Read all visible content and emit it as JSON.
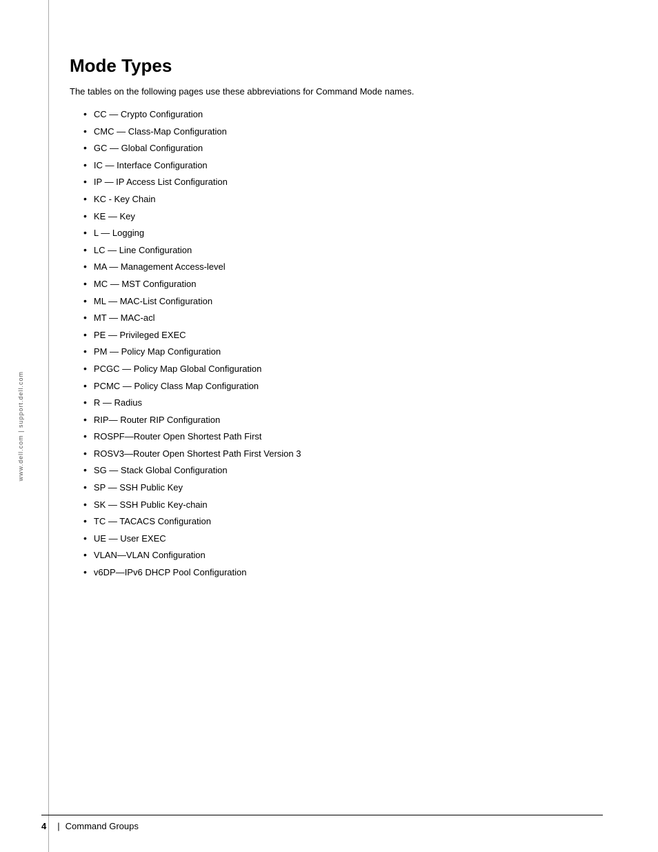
{
  "side_label": {
    "text": "www.dell.com | support.dell.com"
  },
  "page": {
    "title": "Mode Types",
    "intro": "The tables on the following pages use these abbreviations for Command Mode names.",
    "bullet_items": [
      "CC — Crypto Configuration",
      "CMC — Class-Map Configuration",
      "GC — Global Configuration",
      "IC — Interface Configuration",
      "IP — IP Access List Configuration",
      "KC - Key Chain",
      "KE — Key",
      "L — Logging",
      "LC — Line Configuration",
      "MA — Management Access-level",
      "MC — MST Configuration",
      "ML — MAC-List Configuration",
      "MT — MAC-acl",
      "PE — Privileged EXEC",
      "PM — Policy Map Configuration",
      "PCGC — Policy Map Global Configuration",
      "PCMC — Policy Class Map Configuration",
      "R — Radius",
      "RIP— Router RIP Configuration",
      "ROSPF—Router Open Shortest Path First",
      "ROSV3—Router Open Shortest Path First Version 3",
      "SG — Stack Global Configuration",
      "SP — SSH Public Key",
      "SK — SSH Public Key-chain",
      "TC — TACACS Configuration",
      "UE — User EXEC",
      "VLAN—VLAN Configuration",
      "v6DP—IPv6 DHCP Pool Configuration"
    ]
  },
  "footer": {
    "page_number": "4",
    "separator": "|",
    "text": "Command Groups"
  }
}
